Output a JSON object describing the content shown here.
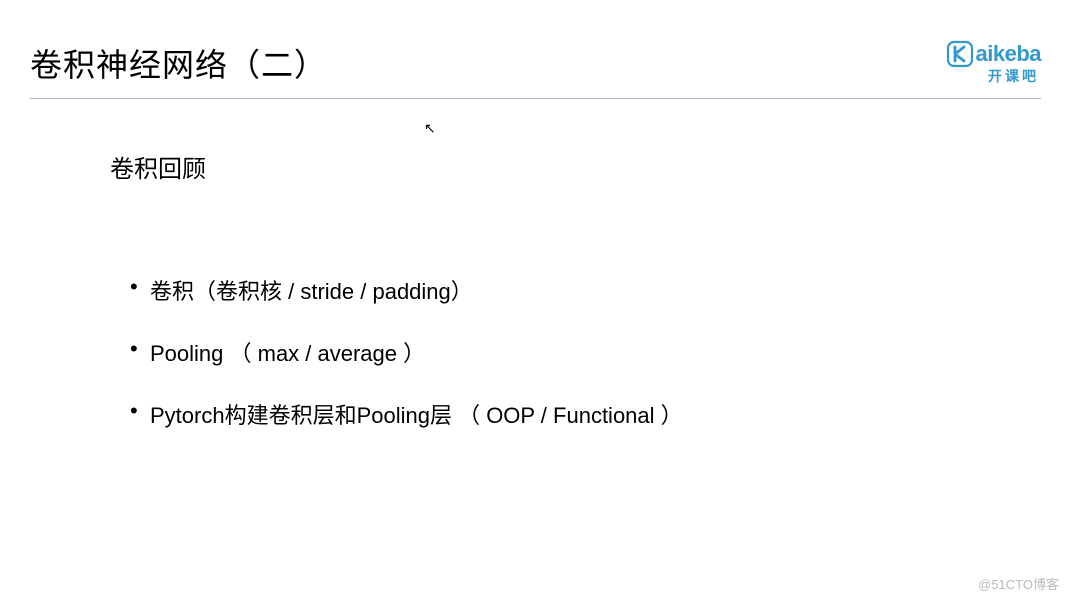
{
  "slide": {
    "title": "卷积神经网络（二）",
    "subtitle": "卷积回顾",
    "bullets": [
      "卷积（卷积核 / stride / padding）",
      "Pooling （ max / average ）",
      "Pytorch构建卷积层和Pooling层 （ OOP / Functional ）"
    ]
  },
  "logo": {
    "main": "aikeba",
    "sub": "开课吧"
  },
  "watermark": "@51CTO博客"
}
